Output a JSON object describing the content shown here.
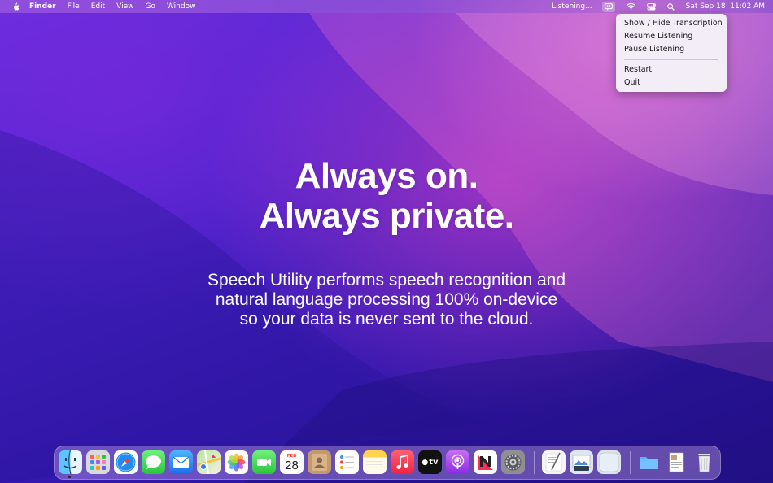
{
  "menubar": {
    "app_name": "Finder",
    "menus": [
      "File",
      "Edit",
      "View",
      "Go",
      "Window"
    ],
    "status_text": "Listening...",
    "clock": "Sat Sep 18  11:02 AM",
    "icons": [
      "apple-icon",
      "speech-utility-icon",
      "wifi-icon",
      "control-center-icon",
      "spotlight-icon"
    ]
  },
  "status_menu": {
    "items": [
      "Show / Hide Transcription",
      "Resume Listening",
      "Pause Listening",
      "Restart",
      "Quit"
    ]
  },
  "hero": {
    "headline_line1": "Always on.",
    "headline_line2": "Always private.",
    "body_line1": "Speech Utility performs speech recognition and",
    "body_line2": "natural language processing 100% on-device",
    "body_line3": "so your data is never sent to the cloud."
  },
  "dock": {
    "apps": [
      "Finder",
      "Launchpad",
      "Safari",
      "Messages",
      "Mail",
      "Maps",
      "Photos",
      "FaceTime",
      "Calendar",
      "Contacts",
      "Reminders",
      "Notes",
      "Music",
      "TV",
      "Podcasts",
      "News",
      "System Preferences",
      "TextEdit",
      "Preview",
      "App",
      "Downloads",
      "Document",
      "Trash"
    ],
    "calendar_month": "FEB",
    "calendar_day": "28",
    "tv_label": "tv"
  },
  "colors": {
    "accent": "#e040c8",
    "wallpaper_base": "#3b1fb0"
  }
}
